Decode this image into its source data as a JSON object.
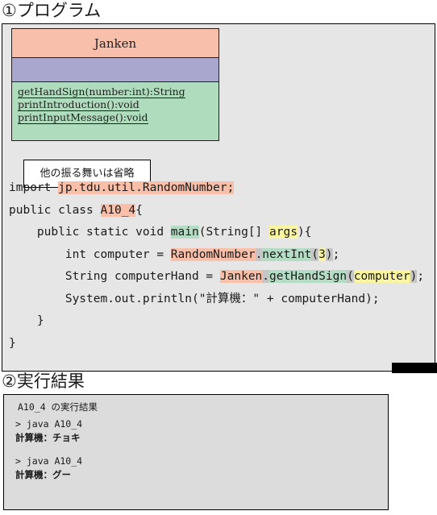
{
  "headings": {
    "program": "①プログラム",
    "result": "②実行結果"
  },
  "uml": {
    "class_name": "Janken",
    "attributes": [],
    "operations": [
      "getHandSign(number:int):String",
      "printIntroduction():void",
      "printInputMessage():void"
    ],
    "note": "他の振る舞いは省略",
    "colors": {
      "name_bg": "#f8c0aa",
      "attr_bg": "#aaa7ce",
      "ops_bg": "#aedcbd",
      "border": "#231f20"
    }
  },
  "code": {
    "lines": [
      [
        {
          "t": "import ",
          "h": "none"
        },
        {
          "t": "jp.tdu.util.RandomNumber;",
          "h": "salmon"
        }
      ],
      [
        {
          "t": "public class ",
          "h": "none"
        },
        {
          "t": "A10_4",
          "h": "salmon"
        },
        {
          "t": "{",
          "h": "none"
        }
      ],
      [
        {
          "t": "    public static void ",
          "h": "none"
        },
        {
          "t": "main",
          "h": "green"
        },
        {
          "t": "(String[] ",
          "h": "none"
        },
        {
          "t": "args",
          "h": "yellow"
        },
        {
          "t": "){",
          "h": "none"
        }
      ],
      [
        {
          "t": "        int computer = ",
          "h": "none"
        },
        {
          "t": "RandomNumber",
          "h": "salmon"
        },
        {
          "t": ".",
          "h": "gray"
        },
        {
          "t": "nextInt",
          "h": "green"
        },
        {
          "t": "(",
          "h": "gray"
        },
        {
          "t": "3",
          "h": "yellow"
        },
        {
          "t": ")",
          "h": "gray"
        },
        {
          "t": ";",
          "h": "none"
        }
      ],
      [
        {
          "t": "        String computerHand = ",
          "h": "none"
        },
        {
          "t": "Janken",
          "h": "salmon"
        },
        {
          "t": ".",
          "h": "gray"
        },
        {
          "t": "getHandSign",
          "h": "green"
        },
        {
          "t": "(",
          "h": "gray"
        },
        {
          "t": "computer",
          "h": "yellow"
        },
        {
          "t": ")",
          "h": "gray"
        },
        {
          "t": ";",
          "h": "none"
        }
      ],
      [
        {
          "t": "        System.out.println(\"計算機：\" + computerHand);",
          "h": "none"
        }
      ],
      [
        {
          "t": "    }",
          "h": "none"
        }
      ],
      [
        {
          "t": "}",
          "h": "none"
        }
      ]
    ],
    "highlight_colors": {
      "salmon": "#f9bfa9",
      "green": "#b4dcc4",
      "yellow": "#fbf5a0",
      "gray": "#c6c6c6"
    }
  },
  "result": {
    "title": "A10_4 の実行結果",
    "runs": [
      {
        "command": "> java A10_4",
        "output": "計算機：チョキ"
      },
      {
        "command": "> java A10_4",
        "output": "計算機：グー"
      }
    ]
  }
}
